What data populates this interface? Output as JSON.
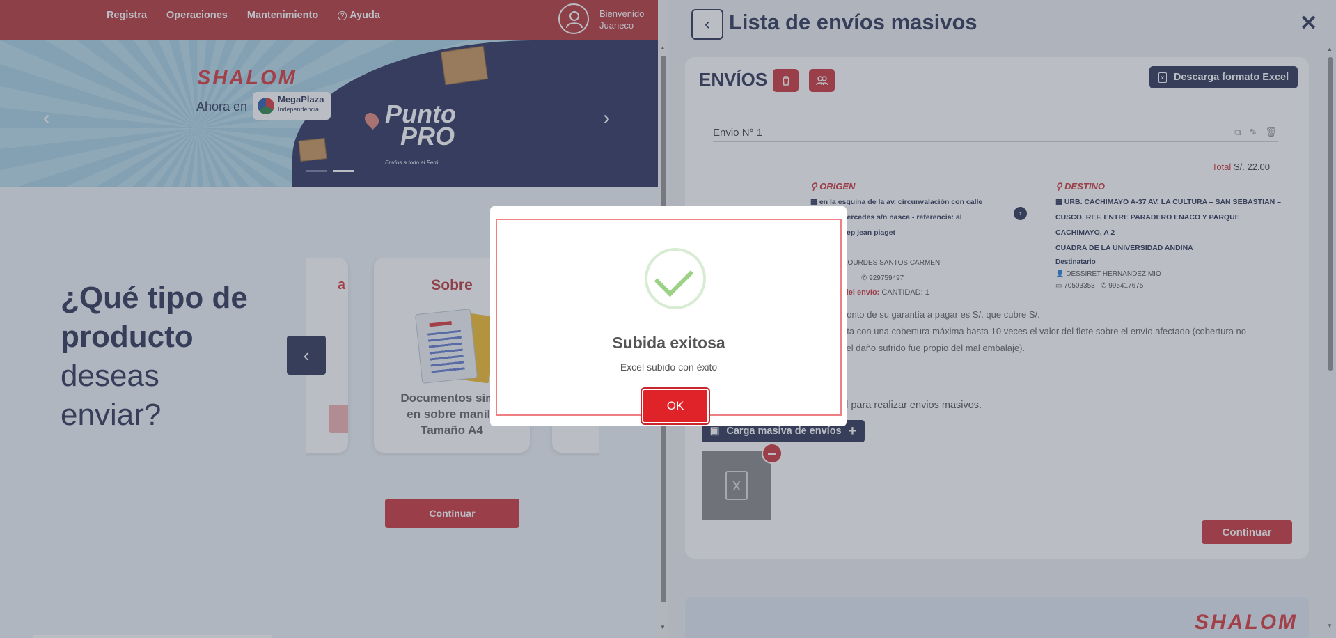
{
  "nav": {
    "items": [
      "Registra",
      "Operaciones",
      "Mantenimiento"
    ],
    "help": "Ayuda",
    "welcome_line1": "Bienvenido",
    "welcome_line2": "Juaneco"
  },
  "banner": {
    "brand": "SHALOM",
    "ahora": "Ahora en",
    "mall_name": "MegaPlaza",
    "mall_sub": "Independencia",
    "punto": "Punto",
    "pro": "PRO",
    "tagline": "Envíos a todo el Perú"
  },
  "product_section": {
    "question_line1": "¿Qué tipo de",
    "question_line2": "producto",
    "question_line3": "deseas",
    "question_line4": "enviar?",
    "left_card_title_fragment": "a",
    "card_title": "Sobre",
    "card_desc_line1": "Documentos simp",
    "card_desc_line2": "en sobre manila",
    "card_desc_line3": "Tamaño A4",
    "continue_label": "Continuar"
  },
  "panel": {
    "title": "Lista de envíos masivos",
    "envios_title": "ENVÍOS",
    "download_label": "Descarga formato Excel",
    "envio_label": "Envio N° 1",
    "total_label": "Total",
    "total_value": "S/. 22.00",
    "origen": {
      "heading": "ORIGEN",
      "address_line1": "en la esquina de la av. circunvalación con calle",
      "address_line2": "le las mercedes s/n nasca - referencia: al",
      "address_line3": "ep jean piaget",
      "contact": "LOURDES SANTOS CARMEN",
      "phone": "929759497",
      "label_envio": "del envío:",
      "cantidad": "CANTIDAD: 1"
    },
    "destino": {
      "heading": "DESTINO",
      "address_line1": "URB. CACHIMAYO A-37 AV. LA CULTURA – SAN SEBASTIAN –",
      "address_line2": "CUSCO, REF. ENTRE PARADERO ENACO Y PARQUE CACHIMAYO, A 2",
      "address_line3": "CUADRA DE LA UNIVERSIDAD ANDINA",
      "destinatario_label": "Destinatario",
      "name": "DESSIRET HERNANDEZ MIO",
      "doc": "70503353",
      "phone": "995417675"
    },
    "garantia_line1": "nonto de su garantía a pagar es S/. que cubre S/.",
    "garantia_line2": "nta con una cobertura máxima hasta 10 veces el valor del flete sobre el envío afectado (cobertura no",
    "garantia_line3": "i el daño sufrido fue propio del mal embalaje).",
    "upload_text": "el para realizar envios masivos.",
    "bulk_label": "Carga masiva de envíos",
    "continue_label": "Continuar",
    "footer_brand": "SHALOM"
  },
  "modal": {
    "title": "Subida exitosa",
    "text": "Excel subido con éxito",
    "ok_label": "OK"
  },
  "colors": {
    "brand_red": "#b3262c",
    "navy": "#1c2447",
    "success_green": "#9cd285"
  }
}
